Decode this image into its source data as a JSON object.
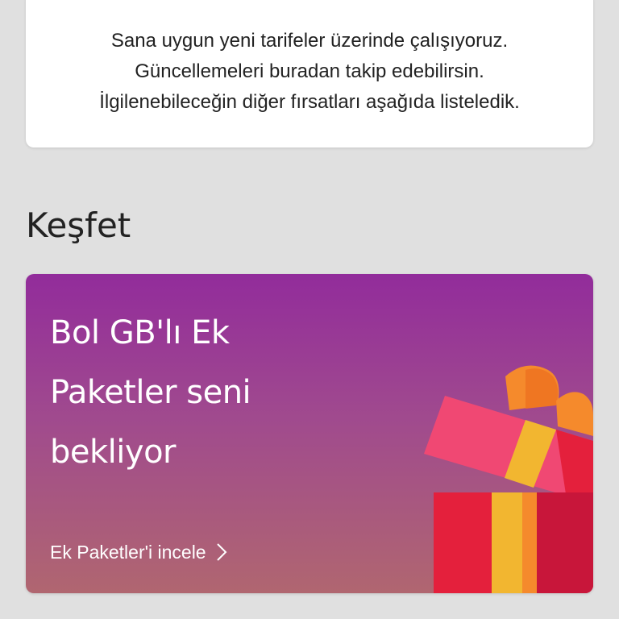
{
  "info_card": {
    "lines": [
      "Sana uygun yeni tarifeler üzerinde çalışıyoruz.",
      "Güncellemeleri buradan takip edebilirsin.",
      "İlgilenebileceğin diğer fırsatları aşağıda listeledik."
    ]
  },
  "section": {
    "title": "Keşfet"
  },
  "promo": {
    "headline_lines": [
      "Bol GB'lı Ek",
      "Paketler seni",
      "bekliyor"
    ],
    "link_label": "Ek Paketler'i incele",
    "link_icon": "chevron-right-icon",
    "image_icon": "gift-box-icon"
  },
  "colors": {
    "background": "#e0e0e0",
    "card": "#ffffff",
    "promo_top": "#922c9b",
    "promo_bottom": "#b06670",
    "gift_red": "#e4203c",
    "gift_orange": "#f58a2c",
    "gift_yellow": "#f2b630",
    "gift_pink": "#f04873"
  }
}
